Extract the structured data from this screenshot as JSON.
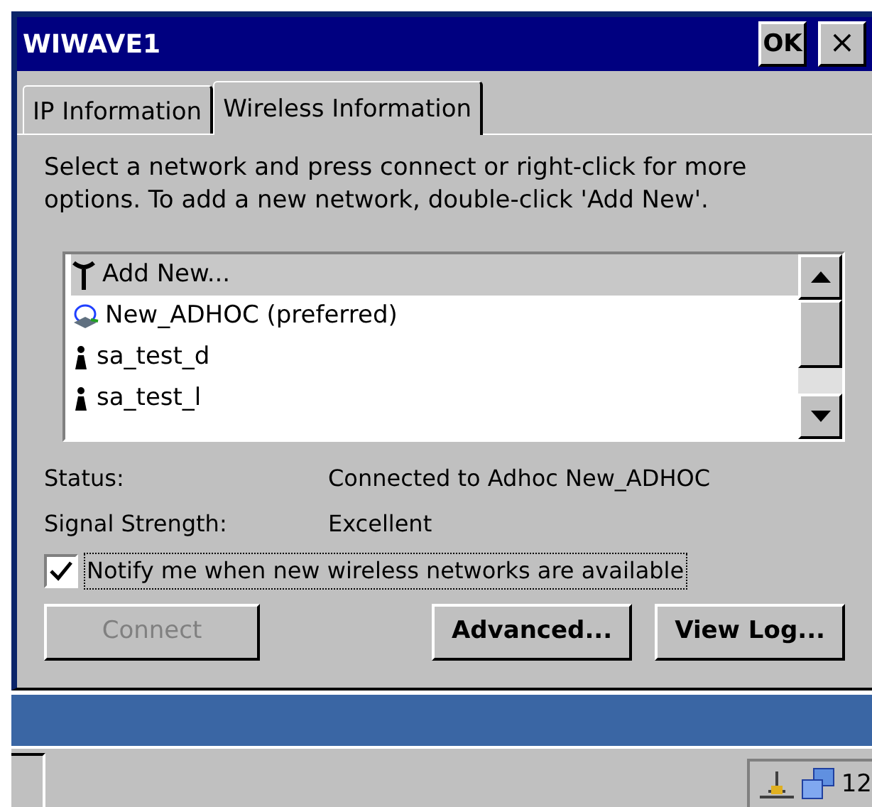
{
  "window": {
    "title": "WIWAVE1",
    "ok_button": "OK",
    "close_button": "×"
  },
  "tabs": [
    {
      "label": "IP Information",
      "selected": false
    },
    {
      "label": "Wireless Information",
      "selected": true
    }
  ],
  "instructions": "Select a network and press connect or right-click for more options.  To add a new network, double-click 'Add New'.",
  "networks": [
    {
      "name": "Add New...",
      "kind": "add",
      "selected": true
    },
    {
      "name": "New_ADHOC (preferred)",
      "kind": "adhoc",
      "selected": false
    },
    {
      "name": "sa_test_d",
      "kind": "infra",
      "selected": false
    },
    {
      "name": "sa_test_l",
      "kind": "infra",
      "selected": false
    }
  ],
  "status": [
    {
      "label": "Status:",
      "value": "Connected to Adhoc New_ADHOC"
    },
    {
      "label": "Signal Strength:",
      "value": "Excellent"
    }
  ],
  "notify": {
    "label": "Notify me when new wireless networks are available",
    "checked": true
  },
  "buttons": [
    {
      "label": "Connect",
      "disabled": true
    },
    {
      "label": "Advanced...",
      "disabled": false
    },
    {
      "label": "View Log...",
      "disabled": false
    }
  ],
  "taskbar": {
    "clock": "12"
  }
}
